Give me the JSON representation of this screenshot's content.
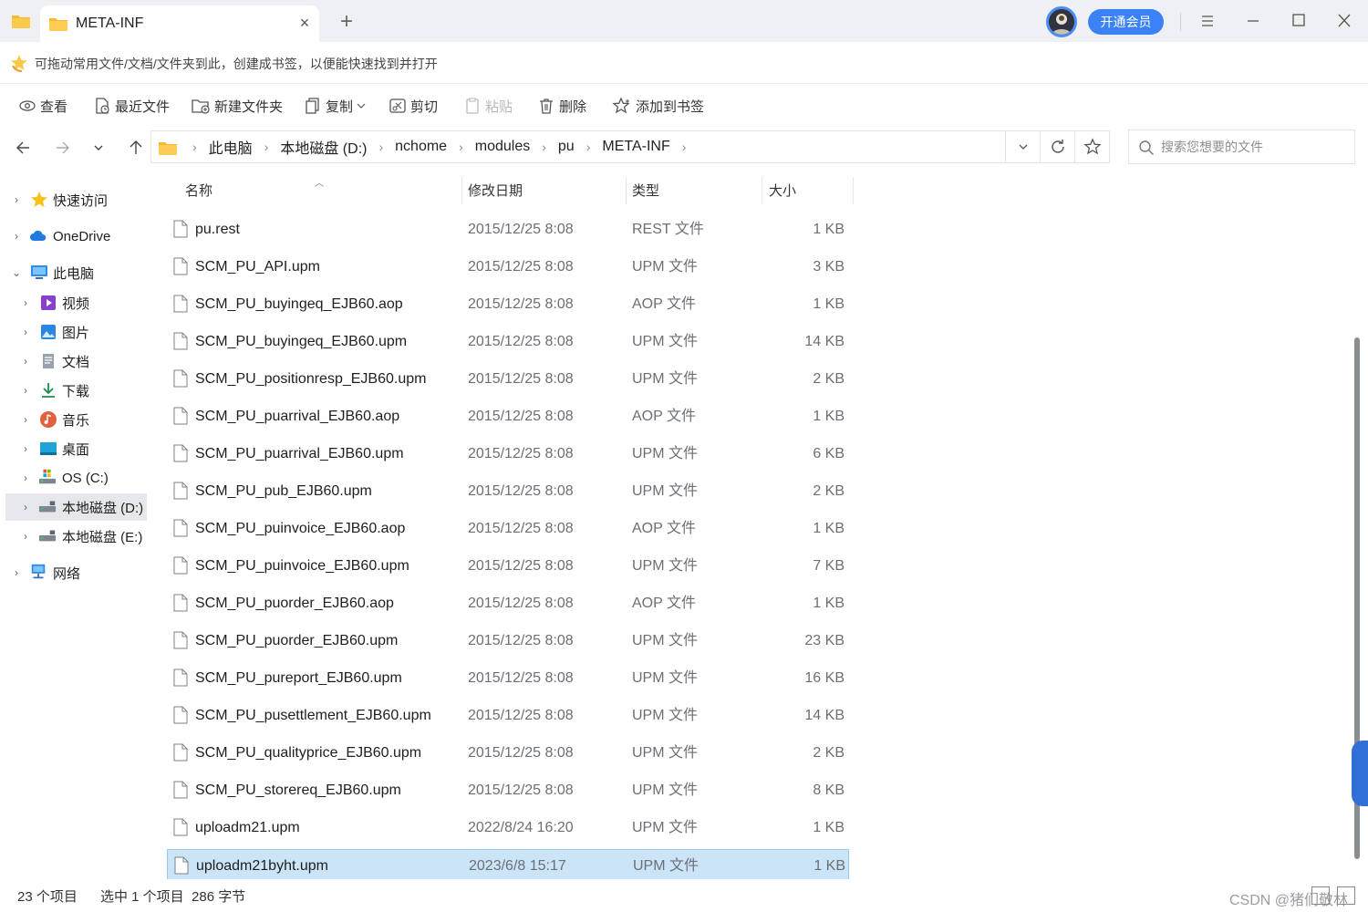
{
  "tab": {
    "title": "META-INF",
    "close_glyph": "×",
    "new_glyph": "+"
  },
  "header": {
    "vip_label": "开通会员"
  },
  "bookmark_hint": "可拖动常用文件/文档/文件夹到此，创建成书签，以便能快速找到并打开",
  "toolbar": {
    "view": "查看",
    "recent": "最近文件",
    "new_folder": "新建文件夹",
    "copy": "复制",
    "cut": "剪切",
    "paste": "粘贴",
    "delete": "删除",
    "add_bookmark": "添加到书签"
  },
  "address": {
    "crumbs": [
      "此电脑",
      "本地磁盘 (D:)",
      "nchome",
      "modules",
      "pu",
      "META-INF"
    ]
  },
  "search": {
    "placeholder": "搜索您想要的文件"
  },
  "sidebar": {
    "items": [
      {
        "label": "快速访问",
        "icon": "star-icon"
      },
      {
        "label": "OneDrive",
        "icon": "cloud-icon"
      },
      {
        "label": "此电脑",
        "icon": "computer-icon"
      },
      {
        "label": "视频",
        "icon": "video-icon"
      },
      {
        "label": "图片",
        "icon": "picture-icon"
      },
      {
        "label": "文档",
        "icon": "document-icon"
      },
      {
        "label": "下载",
        "icon": "download-icon"
      },
      {
        "label": "音乐",
        "icon": "music-icon"
      },
      {
        "label": "桌面",
        "icon": "desktop-icon"
      },
      {
        "label": "OS (C:)",
        "icon": "drive-icon"
      },
      {
        "label": "本地磁盘 (D:)",
        "icon": "drive-icon"
      },
      {
        "label": "本地磁盘 (E:)",
        "icon": "drive-icon"
      },
      {
        "label": "网络",
        "icon": "network-icon"
      }
    ]
  },
  "columns": {
    "name": "名称",
    "date": "修改日期",
    "type": "类型",
    "size": "大小"
  },
  "files": [
    {
      "name": "pu.rest",
      "date": "2015/12/25 8:08",
      "type": "REST 文件",
      "size": "1 KB"
    },
    {
      "name": "SCM_PU_API.upm",
      "date": "2015/12/25 8:08",
      "type": "UPM 文件",
      "size": "3 KB"
    },
    {
      "name": "SCM_PU_buyingeq_EJB60.aop",
      "date": "2015/12/25 8:08",
      "type": "AOP 文件",
      "size": "1 KB"
    },
    {
      "name": "SCM_PU_buyingeq_EJB60.upm",
      "date": "2015/12/25 8:08",
      "type": "UPM 文件",
      "size": "14 KB"
    },
    {
      "name": "SCM_PU_positionresp_EJB60.upm",
      "date": "2015/12/25 8:08",
      "type": "UPM 文件",
      "size": "2 KB"
    },
    {
      "name": "SCM_PU_puarrival_EJB60.aop",
      "date": "2015/12/25 8:08",
      "type": "AOP 文件",
      "size": "1 KB"
    },
    {
      "name": "SCM_PU_puarrival_EJB60.upm",
      "date": "2015/12/25 8:08",
      "type": "UPM 文件",
      "size": "6 KB"
    },
    {
      "name": "SCM_PU_pub_EJB60.upm",
      "date": "2015/12/25 8:08",
      "type": "UPM 文件",
      "size": "2 KB"
    },
    {
      "name": "SCM_PU_puinvoice_EJB60.aop",
      "date": "2015/12/25 8:08",
      "type": "AOP 文件",
      "size": "1 KB"
    },
    {
      "name": "SCM_PU_puinvoice_EJB60.upm",
      "date": "2015/12/25 8:08",
      "type": "UPM 文件",
      "size": "7 KB"
    },
    {
      "name": "SCM_PU_puorder_EJB60.aop",
      "date": "2015/12/25 8:08",
      "type": "AOP 文件",
      "size": "1 KB"
    },
    {
      "name": "SCM_PU_puorder_EJB60.upm",
      "date": "2015/12/25 8:08",
      "type": "UPM 文件",
      "size": "23 KB"
    },
    {
      "name": "SCM_PU_pureport_EJB60.upm",
      "date": "2015/12/25 8:08",
      "type": "UPM 文件",
      "size": "16 KB"
    },
    {
      "name": "SCM_PU_pusettlement_EJB60.upm",
      "date": "2015/12/25 8:08",
      "type": "UPM 文件",
      "size": "14 KB"
    },
    {
      "name": "SCM_PU_qualityprice_EJB60.upm",
      "date": "2015/12/25 8:08",
      "type": "UPM 文件",
      "size": "2 KB"
    },
    {
      "name": "SCM_PU_storereq_EJB60.upm",
      "date": "2015/12/25 8:08",
      "type": "UPM 文件",
      "size": "8 KB"
    },
    {
      "name": "uploadm21.upm",
      "date": "2022/8/24 16:20",
      "type": "UPM 文件",
      "size": "1 KB"
    },
    {
      "name": "uploadm21byht.upm",
      "date": "2023/6/8 15:17",
      "type": "UPM 文件",
      "size": "1 KB",
      "selected": true
    }
  ],
  "status": {
    "item_count": "23 个项目",
    "selection": "选中 1 个项目  286 字节"
  },
  "watermark": "CSDN @猪们敬林",
  "colors": {
    "accent": "#3b82f6",
    "selection_bg": "#cce4f7",
    "selection_border": "#99c9ef"
  }
}
